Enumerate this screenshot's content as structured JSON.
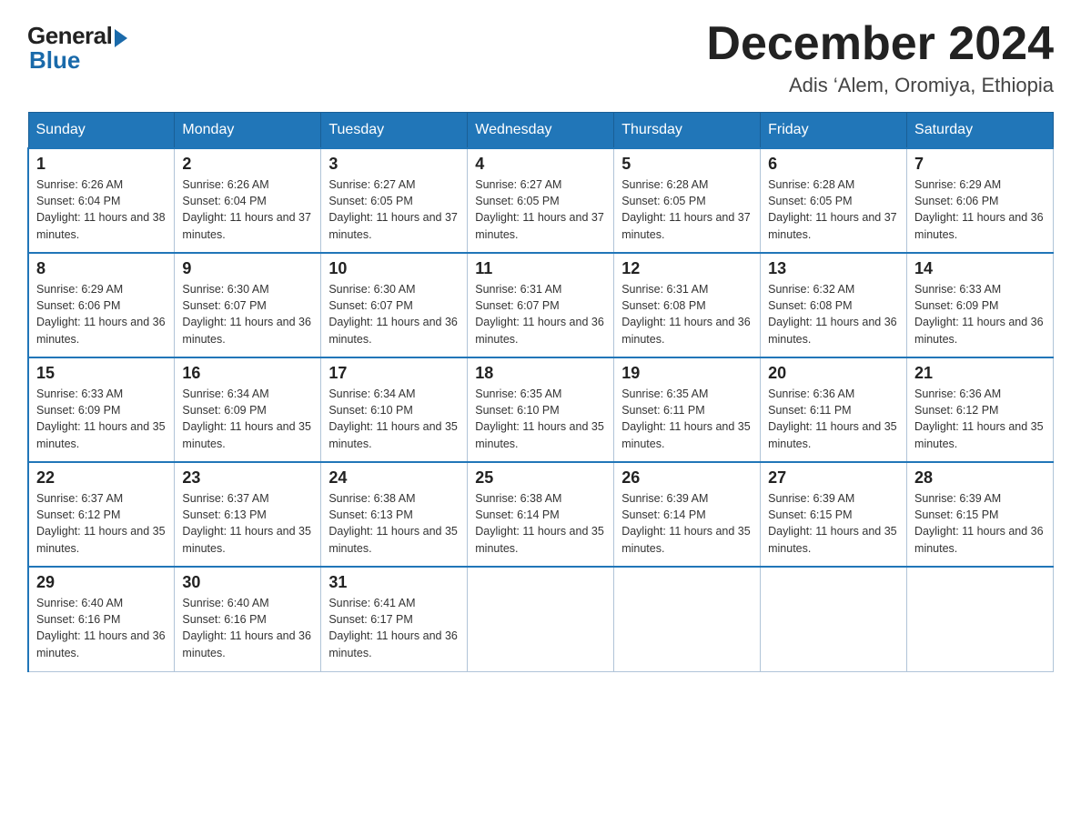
{
  "header": {
    "logo_general": "General",
    "logo_blue": "Blue",
    "month_title": "December 2024",
    "location": "Adis ‘Alem, Oromiya, Ethiopia"
  },
  "weekdays": [
    "Sunday",
    "Monday",
    "Tuesday",
    "Wednesday",
    "Thursday",
    "Friday",
    "Saturday"
  ],
  "weeks": [
    [
      {
        "day": "1",
        "sunrise": "Sunrise: 6:26 AM",
        "sunset": "Sunset: 6:04 PM",
        "daylight": "Daylight: 11 hours and 38 minutes."
      },
      {
        "day": "2",
        "sunrise": "Sunrise: 6:26 AM",
        "sunset": "Sunset: 6:04 PM",
        "daylight": "Daylight: 11 hours and 37 minutes."
      },
      {
        "day": "3",
        "sunrise": "Sunrise: 6:27 AM",
        "sunset": "Sunset: 6:05 PM",
        "daylight": "Daylight: 11 hours and 37 minutes."
      },
      {
        "day": "4",
        "sunrise": "Sunrise: 6:27 AM",
        "sunset": "Sunset: 6:05 PM",
        "daylight": "Daylight: 11 hours and 37 minutes."
      },
      {
        "day": "5",
        "sunrise": "Sunrise: 6:28 AM",
        "sunset": "Sunset: 6:05 PM",
        "daylight": "Daylight: 11 hours and 37 minutes."
      },
      {
        "day": "6",
        "sunrise": "Sunrise: 6:28 AM",
        "sunset": "Sunset: 6:05 PM",
        "daylight": "Daylight: 11 hours and 37 minutes."
      },
      {
        "day": "7",
        "sunrise": "Sunrise: 6:29 AM",
        "sunset": "Sunset: 6:06 PM",
        "daylight": "Daylight: 11 hours and 36 minutes."
      }
    ],
    [
      {
        "day": "8",
        "sunrise": "Sunrise: 6:29 AM",
        "sunset": "Sunset: 6:06 PM",
        "daylight": "Daylight: 11 hours and 36 minutes."
      },
      {
        "day": "9",
        "sunrise": "Sunrise: 6:30 AM",
        "sunset": "Sunset: 6:07 PM",
        "daylight": "Daylight: 11 hours and 36 minutes."
      },
      {
        "day": "10",
        "sunrise": "Sunrise: 6:30 AM",
        "sunset": "Sunset: 6:07 PM",
        "daylight": "Daylight: 11 hours and 36 minutes."
      },
      {
        "day": "11",
        "sunrise": "Sunrise: 6:31 AM",
        "sunset": "Sunset: 6:07 PM",
        "daylight": "Daylight: 11 hours and 36 minutes."
      },
      {
        "day": "12",
        "sunrise": "Sunrise: 6:31 AM",
        "sunset": "Sunset: 6:08 PM",
        "daylight": "Daylight: 11 hours and 36 minutes."
      },
      {
        "day": "13",
        "sunrise": "Sunrise: 6:32 AM",
        "sunset": "Sunset: 6:08 PM",
        "daylight": "Daylight: 11 hours and 36 minutes."
      },
      {
        "day": "14",
        "sunrise": "Sunrise: 6:33 AM",
        "sunset": "Sunset: 6:09 PM",
        "daylight": "Daylight: 11 hours and 36 minutes."
      }
    ],
    [
      {
        "day": "15",
        "sunrise": "Sunrise: 6:33 AM",
        "sunset": "Sunset: 6:09 PM",
        "daylight": "Daylight: 11 hours and 35 minutes."
      },
      {
        "day": "16",
        "sunrise": "Sunrise: 6:34 AM",
        "sunset": "Sunset: 6:09 PM",
        "daylight": "Daylight: 11 hours and 35 minutes."
      },
      {
        "day": "17",
        "sunrise": "Sunrise: 6:34 AM",
        "sunset": "Sunset: 6:10 PM",
        "daylight": "Daylight: 11 hours and 35 minutes."
      },
      {
        "day": "18",
        "sunrise": "Sunrise: 6:35 AM",
        "sunset": "Sunset: 6:10 PM",
        "daylight": "Daylight: 11 hours and 35 minutes."
      },
      {
        "day": "19",
        "sunrise": "Sunrise: 6:35 AM",
        "sunset": "Sunset: 6:11 PM",
        "daylight": "Daylight: 11 hours and 35 minutes."
      },
      {
        "day": "20",
        "sunrise": "Sunrise: 6:36 AM",
        "sunset": "Sunset: 6:11 PM",
        "daylight": "Daylight: 11 hours and 35 minutes."
      },
      {
        "day": "21",
        "sunrise": "Sunrise: 6:36 AM",
        "sunset": "Sunset: 6:12 PM",
        "daylight": "Daylight: 11 hours and 35 minutes."
      }
    ],
    [
      {
        "day": "22",
        "sunrise": "Sunrise: 6:37 AM",
        "sunset": "Sunset: 6:12 PM",
        "daylight": "Daylight: 11 hours and 35 minutes."
      },
      {
        "day": "23",
        "sunrise": "Sunrise: 6:37 AM",
        "sunset": "Sunset: 6:13 PM",
        "daylight": "Daylight: 11 hours and 35 minutes."
      },
      {
        "day": "24",
        "sunrise": "Sunrise: 6:38 AM",
        "sunset": "Sunset: 6:13 PM",
        "daylight": "Daylight: 11 hours and 35 minutes."
      },
      {
        "day": "25",
        "sunrise": "Sunrise: 6:38 AM",
        "sunset": "Sunset: 6:14 PM",
        "daylight": "Daylight: 11 hours and 35 minutes."
      },
      {
        "day": "26",
        "sunrise": "Sunrise: 6:39 AM",
        "sunset": "Sunset: 6:14 PM",
        "daylight": "Daylight: 11 hours and 35 minutes."
      },
      {
        "day": "27",
        "sunrise": "Sunrise: 6:39 AM",
        "sunset": "Sunset: 6:15 PM",
        "daylight": "Daylight: 11 hours and 35 minutes."
      },
      {
        "day": "28",
        "sunrise": "Sunrise: 6:39 AM",
        "sunset": "Sunset: 6:15 PM",
        "daylight": "Daylight: 11 hours and 36 minutes."
      }
    ],
    [
      {
        "day": "29",
        "sunrise": "Sunrise: 6:40 AM",
        "sunset": "Sunset: 6:16 PM",
        "daylight": "Daylight: 11 hours and 36 minutes."
      },
      {
        "day": "30",
        "sunrise": "Sunrise: 6:40 AM",
        "sunset": "Sunset: 6:16 PM",
        "daylight": "Daylight: 11 hours and 36 minutes."
      },
      {
        "day": "31",
        "sunrise": "Sunrise: 6:41 AM",
        "sunset": "Sunset: 6:17 PM",
        "daylight": "Daylight: 11 hours and 36 minutes."
      },
      null,
      null,
      null,
      null
    ]
  ]
}
